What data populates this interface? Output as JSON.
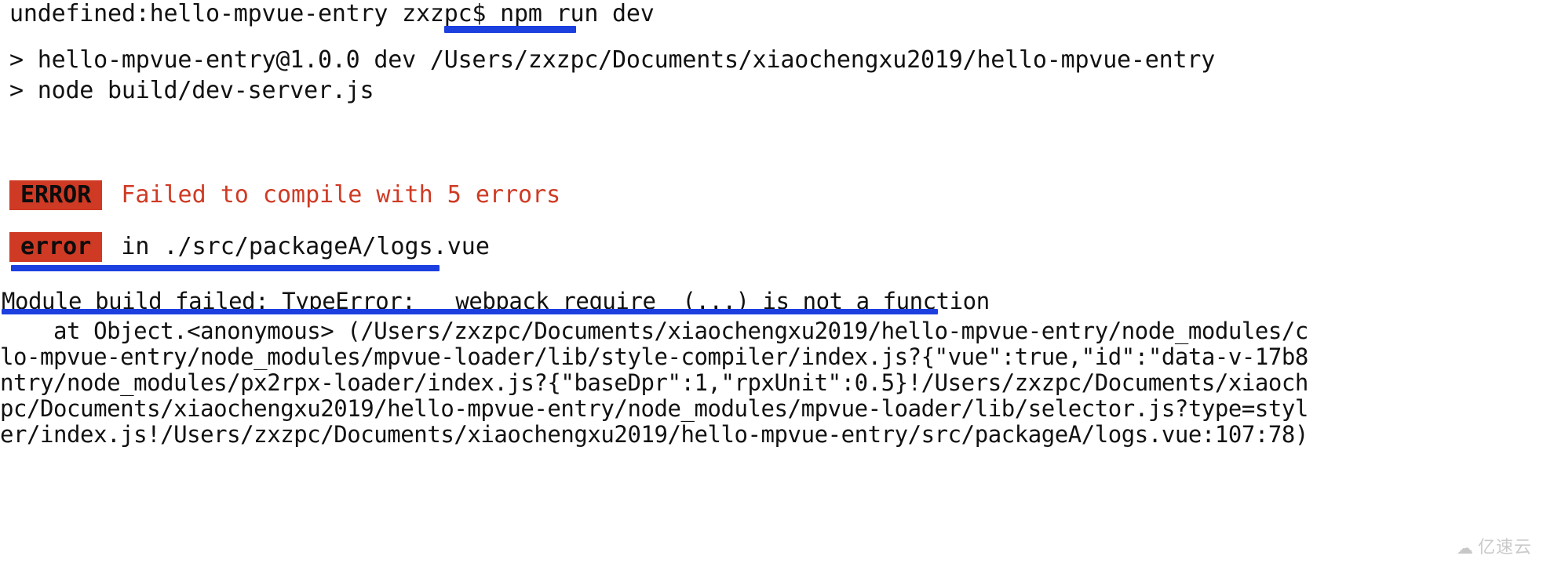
{
  "terminal": {
    "background_color": "#ffffff",
    "text_color": "#111111",
    "accent_red": "#cf3a24",
    "accent_blue": "#1c3fe0",
    "prompt_line": "undefined:hello-mpvue-entry zxzpc$ npm run dev",
    "npm_header_line": "> hello-mpvue-entry@1.0.0 dev /Users/zxzpc/Documents/xiaochengxu2019/hello-mpvue-entry",
    "npm_node_line": "> node build/dev-server.js"
  },
  "error_summary": {
    "badge_label": "ERROR",
    "message": "Failed to compile with 5 errors"
  },
  "error_file": {
    "badge_label": "error",
    "message": "in ./src/packageA/logs.vue"
  },
  "stack": {
    "module_failed": "Module build failed: TypeError: __webpack_require__(...) is not a function",
    "lines": [
      "    at Object.<anonymous> (/Users/zxzpc/Documents/xiaochengxu2019/hello-mpvue-entry/node_modules/c",
      "lo-mpvue-entry/node_modules/mpvue-loader/lib/style-compiler/index.js?{\"vue\":true,\"id\":\"data-v-17b8",
      "ntry/node_modules/px2rpx-loader/index.js?{\"baseDpr\":1,\"rpxUnit\":0.5}!/Users/zxzpc/Documents/xiaoch",
      "pc/Documents/xiaochengxu2019/hello-mpvue-entry/node_modules/mpvue-loader/lib/selector.js?type=styl",
      "er/index.js!/Users/zxzpc/Documents/xiaochengxu2019/hello-mpvue-entry/src/packageA/logs.vue:107:78)"
    ]
  },
  "watermark": {
    "icon": "cloud-icon",
    "glyph": "☁",
    "text": "亿速云"
  }
}
